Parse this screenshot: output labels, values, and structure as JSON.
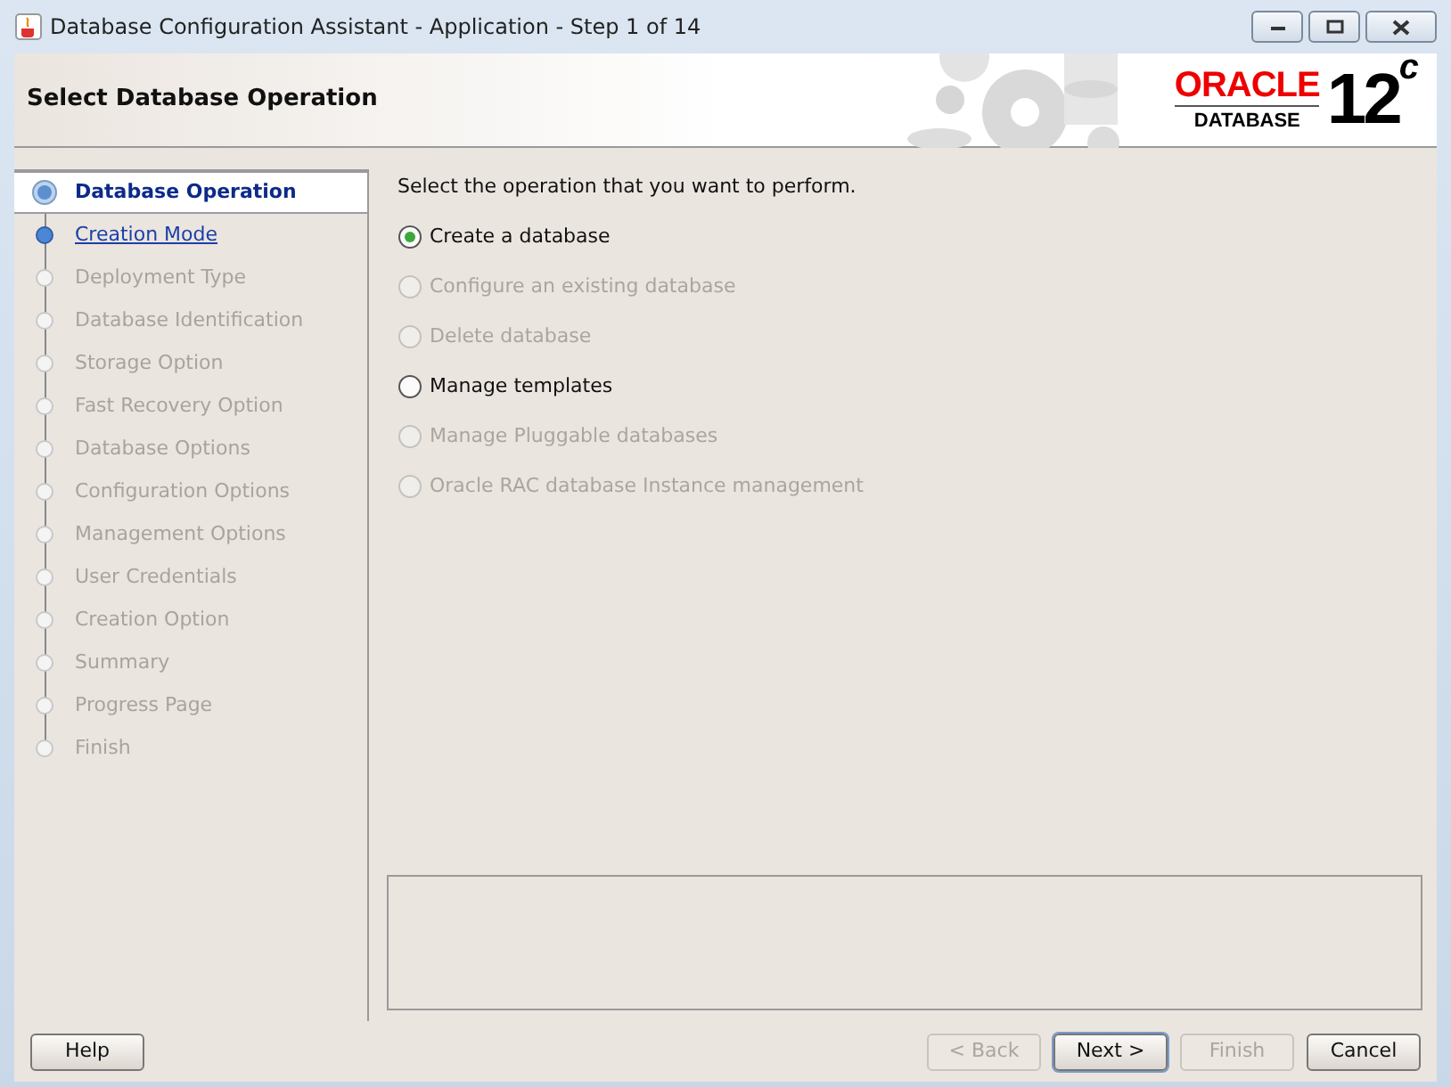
{
  "window": {
    "title": "Database Configuration Assistant - Application - Step 1 of 14"
  },
  "header": {
    "title": "Select Database Operation",
    "logo": {
      "brand": "ORACLE",
      "product": "DATABASE",
      "version": "12",
      "version_sup": "c"
    }
  },
  "steps": [
    {
      "label": "Database Operation",
      "kind": "current"
    },
    {
      "label": "Creation Mode",
      "kind": "link"
    },
    {
      "label": "Deployment Type",
      "kind": "pending"
    },
    {
      "label": "Database Identification",
      "kind": "pending"
    },
    {
      "label": "Storage Option",
      "kind": "pending"
    },
    {
      "label": "Fast Recovery Option",
      "kind": "pending"
    },
    {
      "label": "Database Options",
      "kind": "pending"
    },
    {
      "label": "Configuration Options",
      "kind": "pending"
    },
    {
      "label": "Management Options",
      "kind": "pending"
    },
    {
      "label": "User Credentials",
      "kind": "pending"
    },
    {
      "label": "Creation Option",
      "kind": "pending"
    },
    {
      "label": "Summary",
      "kind": "pending"
    },
    {
      "label": "Progress Page",
      "kind": "pending"
    },
    {
      "label": "Finish",
      "kind": "pending"
    }
  ],
  "prompt": "Select the operation that you want to perform.",
  "options": [
    {
      "label": "Create a database",
      "selected": true,
      "disabled": false
    },
    {
      "label": "Configure an existing database",
      "selected": false,
      "disabled": true
    },
    {
      "label": "Delete database",
      "selected": false,
      "disabled": true
    },
    {
      "label": "Manage templates",
      "selected": false,
      "disabled": false
    },
    {
      "label": "Manage Pluggable databases",
      "selected": false,
      "disabled": true
    },
    {
      "label": "Oracle RAC database Instance management",
      "selected": false,
      "disabled": true
    }
  ],
  "buttons": [
    {
      "label": "Help",
      "disabled": false,
      "default": false
    },
    {
      "label": "< Back",
      "disabled": true,
      "default": false
    },
    {
      "label": "Next >",
      "disabled": false,
      "default": true
    },
    {
      "label": "Finish",
      "disabled": true,
      "default": false
    },
    {
      "label": "Cancel",
      "disabled": false,
      "default": false
    }
  ]
}
